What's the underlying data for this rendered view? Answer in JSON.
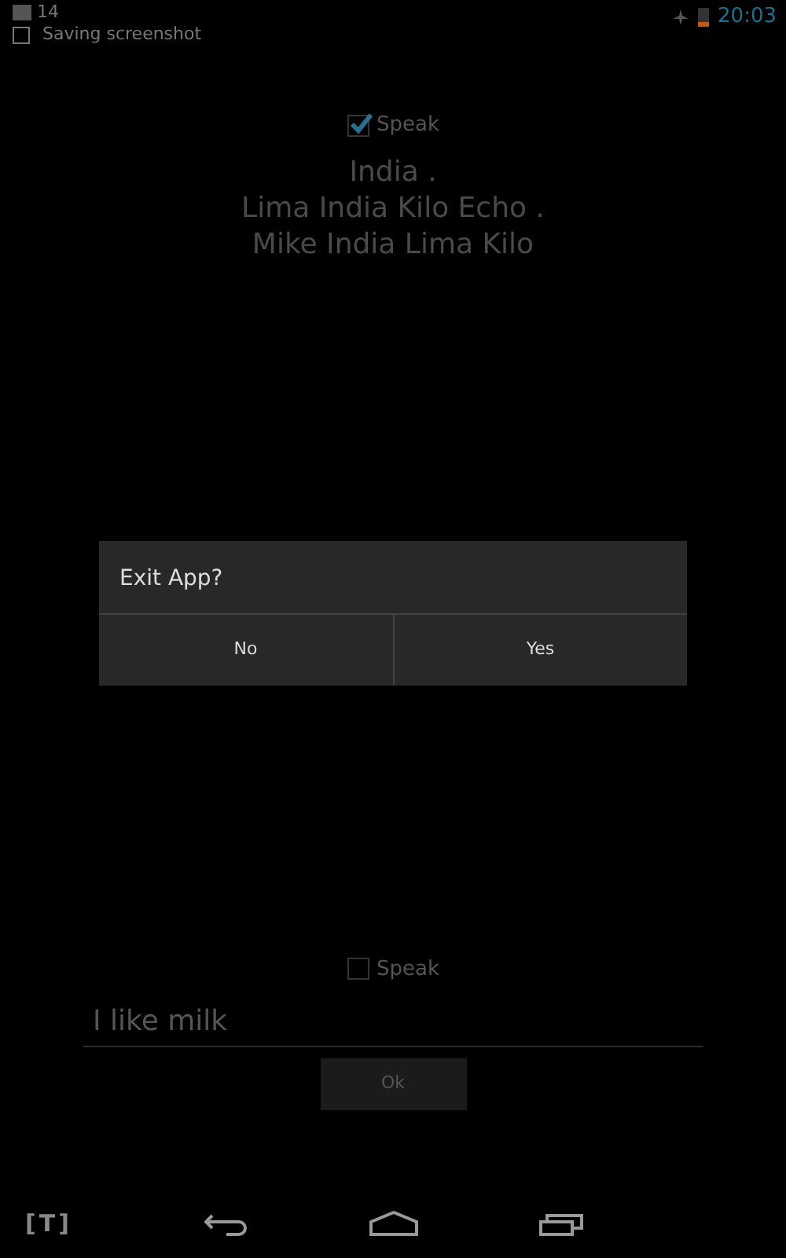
{
  "status_bar": {
    "notification_count": "14",
    "notification": "Saving screenshot",
    "time": "20:03"
  },
  "top": {
    "speak": {
      "label": "Speak",
      "checked": true
    },
    "lines": [
      "India .",
      "Lima India Kilo Echo .",
      "Mike India Lima Kilo"
    ]
  },
  "bottom": {
    "speak": {
      "label": "Speak",
      "checked": false
    },
    "input": {
      "value": "I like milk"
    },
    "ok_button": "Ok"
  },
  "dialog": {
    "title": "Exit App?",
    "buttons": [
      "No",
      "Yes"
    ]
  },
  "nav_bar": {
    "ime_label": "[T]"
  }
}
